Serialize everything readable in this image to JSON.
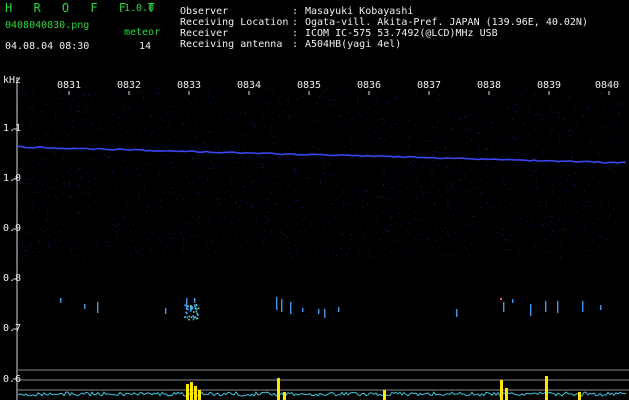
{
  "header": {
    "title": "H R O F F T",
    "version": "1.0.0",
    "filename": "0408040830.png",
    "meteor_label": "meteor",
    "meteor_count": "14",
    "datetime": "04.08.04 08:30",
    "fields": [
      {
        "label": "Observer",
        "sep": ":",
        "value": "Masayuki Kobayashi"
      },
      {
        "label": "Receiving Location",
        "sep": ":",
        "value": "Ogata-vill. Akita-Pref. JAPAN (139.96E, 40.02N)"
      },
      {
        "label": "Receiver",
        "sep": ":",
        "value": "ICOM IC-575 53.7492(@LCD)MHz USB"
      },
      {
        "label": "Receiving antenna",
        "sep": ":",
        "value": "A504HB(yagi 4el)"
      }
    ]
  },
  "axes": {
    "y_unit": "kHz",
    "y_ticks": [
      "1.1",
      "1.0",
      "0.9",
      "0.8",
      "0.7",
      "0.6"
    ],
    "x_ticks": [
      "0831",
      "0832",
      "0833",
      "0834",
      "0835",
      "0836",
      "0837",
      "0838",
      "0839",
      "0840"
    ]
  },
  "colors": {
    "background": "#000000",
    "header_accent": "#27d73c",
    "trace": "#3a4bff",
    "noise": "#1a1f7a",
    "meteor_echo": "#4da6ff",
    "burst": "#ffe600",
    "baseline": "#3ec8e0"
  }
}
